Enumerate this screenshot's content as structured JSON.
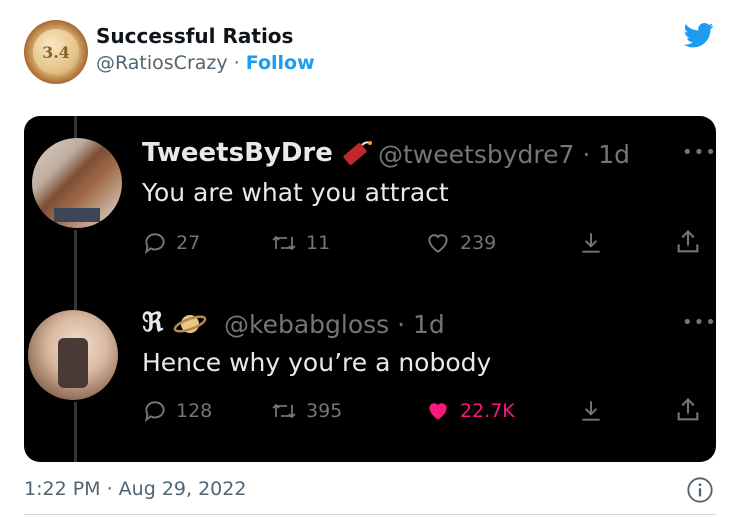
{
  "author": {
    "name": "Successful Ratios",
    "handle": "@RatiosCrazy",
    "separator": "·",
    "follow_label": "Follow",
    "avatar_text": "3.4"
  },
  "colors": {
    "twitter_blue": "#1d9bf0",
    "like_pink": "#f91880",
    "dark_bg": "#000000",
    "muted": "#71767b"
  },
  "replies": [
    {
      "name": "TweetsByDre",
      "name_emoji": "firecracker",
      "handle_time": "@tweetsbydre7 · 1d",
      "text": "You are what you attract",
      "replies_count": "27",
      "retweets_count": "11",
      "likes_count": "239",
      "liked": false
    },
    {
      "name": "ℜ",
      "name_emoji": "ringed-planet",
      "handle_time": "@kebabgloss · 1d",
      "text": "Hence why you’re a nobody",
      "replies_count": "128",
      "retweets_count": "395",
      "likes_count": "22.7K",
      "liked": true
    }
  ],
  "footer": {
    "timestamp": "1:22 PM · Aug 29, 2022"
  }
}
